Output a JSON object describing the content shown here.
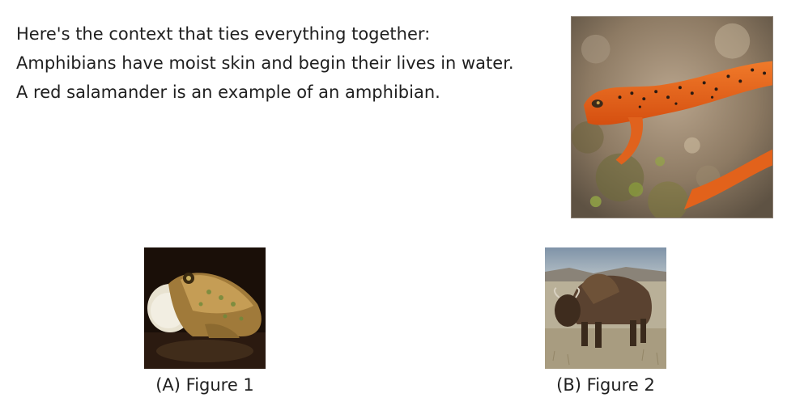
{
  "context": {
    "lines": [
      "Here's the context that ties everything together:",
      "Amphibians have moist skin and begin their lives in water.",
      "A red salamander is an example of an amphibian."
    ]
  },
  "options": [
    {
      "letter": "(A)",
      "label": "Figure 1",
      "icon": "toad-photo"
    },
    {
      "letter": "(B)",
      "label": "Figure 2",
      "icon": "bison-photo"
    }
  ],
  "main_image": {
    "icon": "red-salamander-photo"
  }
}
